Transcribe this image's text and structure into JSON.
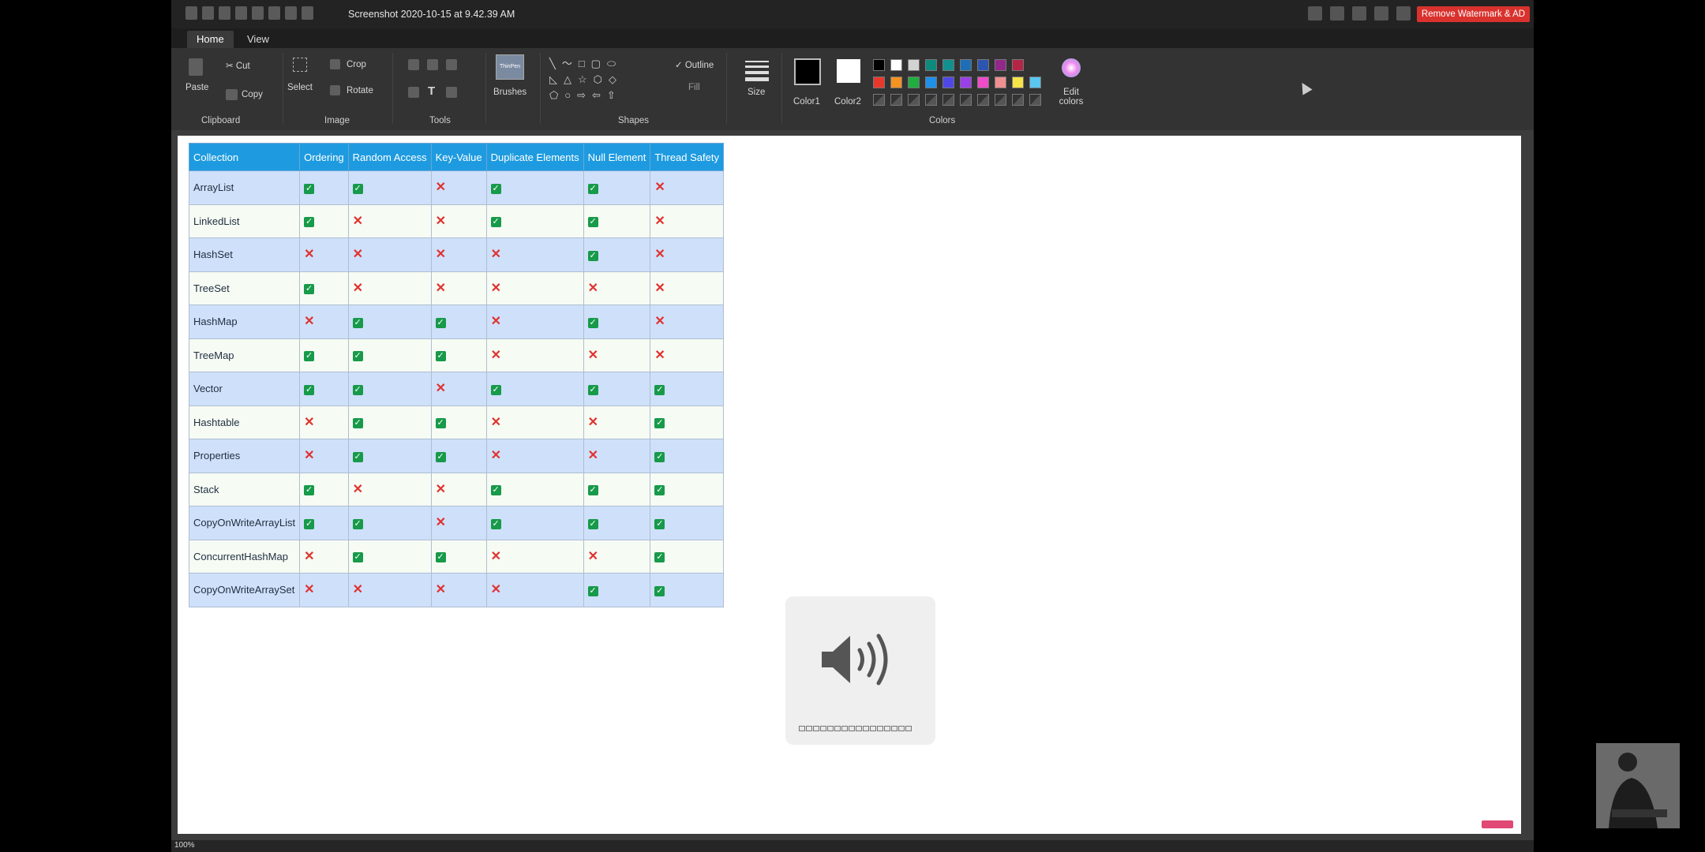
{
  "window": {
    "title": "Screenshot 2020-10-15 at 9.42.39 AM",
    "remove_watermark": "Remove Watermark & AD"
  },
  "tabs": [
    "Home",
    "View"
  ],
  "ribbon": {
    "paste": "Paste",
    "cut": "Cut",
    "copy": "Copy",
    "select": "Select",
    "crop": "Crop",
    "rotate": "Rotate",
    "brushes": "Brushes",
    "brush_preview": "ThinPen",
    "outline": "Outline",
    "fill": "Fill",
    "size": "Size",
    "color1": "Color1",
    "color2": "Color2",
    "edit_colors": "Edit colors",
    "groups": {
      "clipboard": "Clipboard",
      "image": "Image",
      "tools": "Tools",
      "shapes": "Shapes",
      "colors": "Colors"
    },
    "palette_row1": [
      "#000000",
      "#ffffff",
      "#d3d3d3",
      "#0e8a7d",
      "#128f8f",
      "#1d6eb6",
      "#2b55b0",
      "#92288a",
      "#b52545"
    ],
    "palette_row2": [
      "#e8382c",
      "#f39321",
      "#1fae3f",
      "#1f8fe8",
      "#5048e6",
      "#9b3fe8",
      "#ee4cc8",
      "#f08f8f",
      "#f5e347",
      "#5bc6f0"
    ]
  },
  "table": {
    "headers": [
      "Collection",
      "Ordering",
      "Random Access",
      "Key-Value",
      "Duplicate Elements",
      "Null Element",
      "Thread Safety"
    ],
    "rows": [
      {
        "name": "ArrayList",
        "values": [
          true,
          true,
          false,
          true,
          true,
          false
        ]
      },
      {
        "name": "LinkedList",
        "values": [
          true,
          false,
          false,
          true,
          true,
          false
        ]
      },
      {
        "name": "HashSet",
        "values": [
          false,
          false,
          false,
          false,
          true,
          false
        ]
      },
      {
        "name": "TreeSet",
        "values": [
          true,
          false,
          false,
          false,
          false,
          false
        ]
      },
      {
        "name": "HashMap",
        "values": [
          false,
          true,
          true,
          false,
          true,
          false
        ]
      },
      {
        "name": "TreeMap",
        "values": [
          true,
          true,
          true,
          false,
          false,
          false
        ]
      },
      {
        "name": "Vector",
        "values": [
          true,
          true,
          false,
          true,
          true,
          true
        ]
      },
      {
        "name": "Hashtable",
        "values": [
          false,
          true,
          true,
          false,
          false,
          true
        ]
      },
      {
        "name": "Properties",
        "values": [
          false,
          true,
          true,
          false,
          false,
          true
        ]
      },
      {
        "name": "Stack",
        "values": [
          true,
          false,
          false,
          true,
          true,
          true
        ]
      },
      {
        "name": "CopyOnWriteArrayList",
        "values": [
          true,
          true,
          false,
          true,
          true,
          true
        ]
      },
      {
        "name": "ConcurrentHashMap",
        "values": [
          false,
          true,
          true,
          false,
          false,
          true
        ]
      },
      {
        "name": "CopyOnWriteArraySet",
        "values": [
          false,
          false,
          false,
          false,
          true,
          true
        ]
      }
    ]
  },
  "volume": {
    "level": 0
  },
  "status": {
    "zoom": "100%"
  }
}
